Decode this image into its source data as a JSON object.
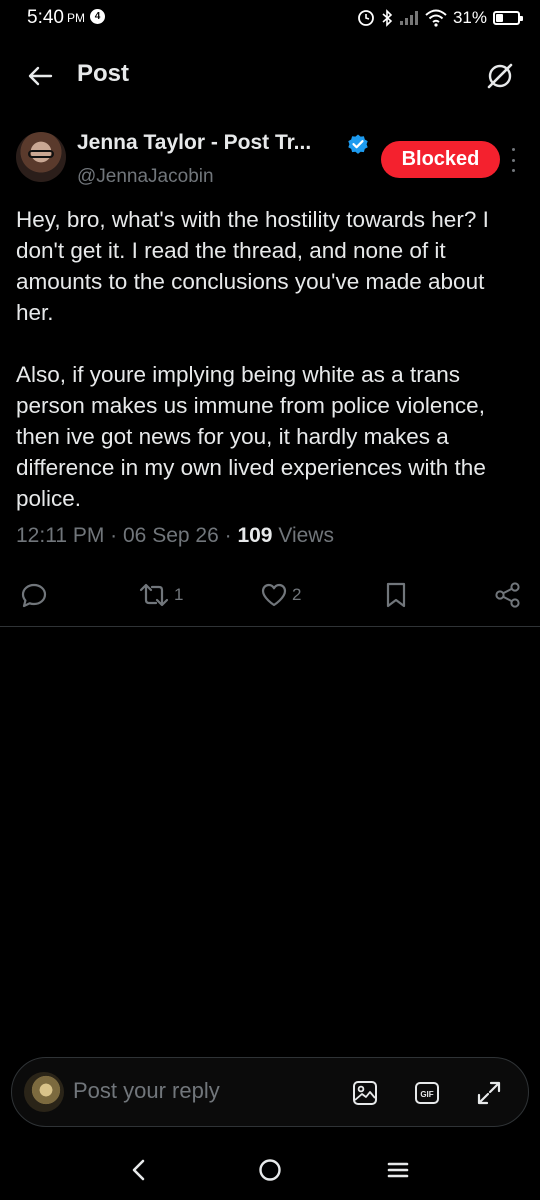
{
  "status_bar": {
    "time": "5:40",
    "ampm": "PM",
    "notification_count": "4",
    "battery_percent": "31%",
    "battery_level": 0.31
  },
  "header": {
    "title": "Post",
    "back_icon": "arrow-left-icon",
    "grok_icon": "grok-icon"
  },
  "post": {
    "author": {
      "display_name": "Jenna Taylor - Post Tr...",
      "handle": "@JennaJacobin",
      "verified": true
    },
    "blocked_label": "Blocked",
    "body_paragraphs": [
      "Hey, bro, what's with the hostility towards her? I don't get it. I read the thread, and none of it amounts to the conclusions you've made about her.",
      "Also, if youre implying being white as a trans person makes us immune from police violence,  then ive got news for you, it hardly makes a difference in my own lived experiences with the police."
    ],
    "meta": {
      "time": "12:11 PM",
      "date": "06 Sep 26",
      "views_count": "109",
      "views_label": "Views"
    },
    "actions": {
      "replies": "",
      "reposts": "1",
      "likes": "2"
    }
  },
  "reply": {
    "placeholder": "Post your reply"
  },
  "colors": {
    "background": "#000000",
    "text": "#e7e9ea",
    "muted": "#71767b",
    "blocked": "#f4212e",
    "verified": "#1d9bf0",
    "divider": "#2f3336"
  }
}
